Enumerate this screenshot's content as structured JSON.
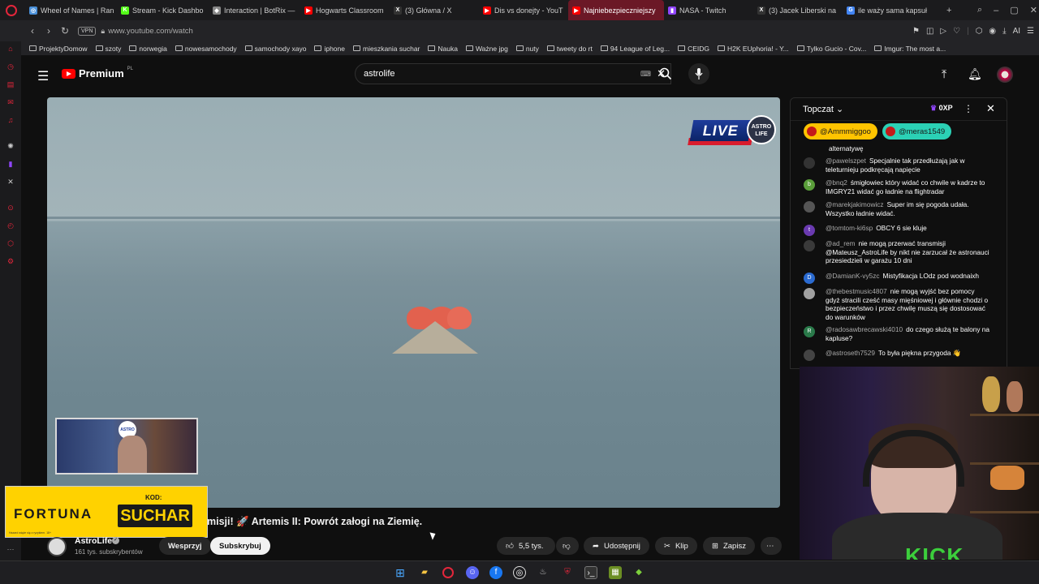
{
  "browser": {
    "tabs": [
      {
        "title": "Wheel of Names | Ran",
        "color": "#4a90d9",
        "glyph": "◎"
      },
      {
        "title": "Stream - Kick Dashbo",
        "color": "#53fc18",
        "glyph": "K"
      },
      {
        "title": "Interaction | BotRix —",
        "color": "#888888",
        "glyph": "◆"
      },
      {
        "title": "Hogwarts Classroom",
        "color": "#ff0000",
        "glyph": "▶"
      },
      {
        "title": "(3) Główna / X",
        "color": "#333333",
        "glyph": "X"
      },
      {
        "title": "Dis vs donejty - YouT",
        "color": "#ff0000",
        "glyph": "▶"
      },
      {
        "title": "Najniebezpieczniejszy",
        "color": "#ff0000",
        "glyph": "▶"
      },
      {
        "title": "NASA - Twitch",
        "color": "#9146ff",
        "glyph": "▮"
      },
      {
        "title": "(3) Jacek Liberski na",
        "color": "#333333",
        "glyph": "X"
      },
      {
        "title": "ile waży sama kapsuł",
        "color": "#4285f4",
        "glyph": "G"
      }
    ],
    "active_tab_index": 6,
    "new_tab": "+",
    "url": "www.youtube.com/watch",
    "vpn_label": "VPN",
    "addr_ai": "AI",
    "bookmarks": [
      "ProjektyDomow",
      "szoty",
      "norwegia",
      "nowesamochody",
      "samochody xayo",
      "iphone",
      "mieszkania suchar",
      "Nauka",
      "Ważne jpg",
      "nuty",
      "tweety do rt",
      "94 League of Leg...",
      "CEIDG",
      "H2K EUphoria! - Y...",
      "Tylko Gucio - Cov...",
      "Imgur: The most a..."
    ]
  },
  "youtube": {
    "logo_text": "Premium",
    "logo_region": "PL",
    "search_value": "astrolife",
    "video_title_visible": "misji! 🚀 Artemis II: Powrót załogi na Ziemię.",
    "channel_name": "AstroLife",
    "channel_subs": "161 tys. subskrybentów",
    "support_label": "Wesprzyj",
    "subscribe_label": "Subskrybuj",
    "like_count": "5,5 tys.",
    "share_label": "Udostępnij",
    "clip_label": "Klip",
    "save_label": "Zapisz",
    "more_label": "⋯"
  },
  "overlay": {
    "live_text": "LIVE",
    "astro_logo_text": "ASTRO LIFE",
    "sponsor_brand": "FORTUNA",
    "sponsor_code_label": "KOD:",
    "sponsor_code": "SUCHAR",
    "sponsor_fineprint": "Hazard wiąże się z ryzykiem. 18+"
  },
  "chat": {
    "title": "Topczat",
    "xp": "0XP",
    "close": "✕",
    "pinned": [
      {
        "name": "@Ammmiggoo",
        "bg": "#ffc400",
        "fg": "#1a1a1a"
      },
      {
        "name": "@meras1549",
        "bg": "#2bd1b5",
        "fg": "#1a1a1a"
      }
    ],
    "messages": [
      {
        "author": "",
        "text": "alternatywę",
        "avatar": "",
        "avcolor": "#0f0f0f"
      },
      {
        "author": "@pawelszpet",
        "text": "Specjalnie tak przedłużają jak w teleturnieju podkręcają napięcie",
        "avatar": "",
        "avcolor": "#333333"
      },
      {
        "author": "@bnq2",
        "text": "śmigłowiec który widać co chwile w kadrze to IMGRY21 widać go ładnie na flightradar",
        "avatar": "b",
        "avcolor": "#5a9e3a"
      },
      {
        "author": "@marekjakimowicz",
        "text": "Super im się pogoda udała. Wszystko ładnie widać.",
        "avatar": "",
        "avcolor": "#555555"
      },
      {
        "author": "@tomtom-ki6sp",
        "text": "OBCY 6 sie kluje",
        "avatar": "t",
        "avcolor": "#6a3ab0"
      },
      {
        "author": "@ad_rem",
        "text": "nie mogą przerwać transmisji @Mateusz_AstroLife by nikt nie zarzucał że astronauci przesiedzieli w garażu 10 dni",
        "avatar": "",
        "avcolor": "#3a3a3a"
      },
      {
        "author": "@DamianK-vy5zc",
        "text": "Mistyfikacja LOdz pod wodnaixh",
        "avatar": "D",
        "avcolor": "#2a6ad0"
      },
      {
        "author": "@thebestmusic4807",
        "text": "nie mogą wyjść bez pomocy gdyż stracili cześć masy mięśniowej i głównie chodzi o bezpieczeństwo i przez chwilę muszą się dostosować do warunków",
        "avatar": "",
        "avcolor": "#a0a0a0"
      },
      {
        "author": "@radosawbrecawski4010",
        "text": "do czego służą te balony na kapluse?",
        "avatar": "R",
        "avcolor": "#2a7a4a"
      },
      {
        "author": "@astroseth7529",
        "text": "To była piękna przygoda 👋",
        "avatar": "",
        "avcolor": "#444444"
      }
    ]
  },
  "webcam": {
    "shirt_text": "KICK"
  }
}
